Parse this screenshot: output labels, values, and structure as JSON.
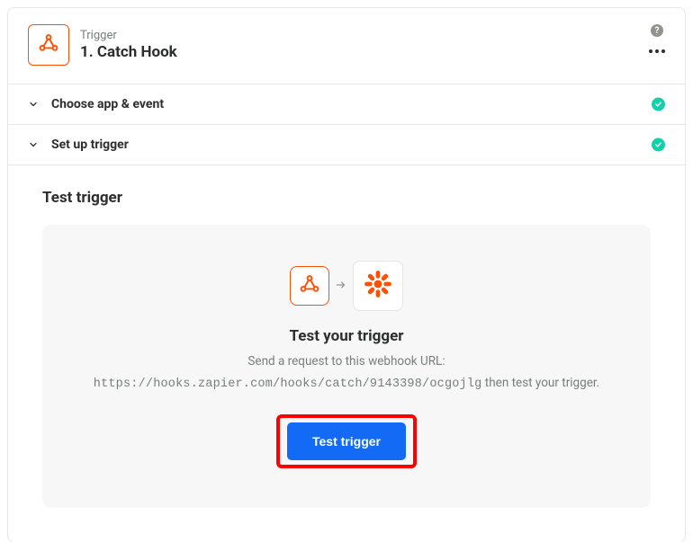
{
  "header": {
    "eyebrow": "Trigger",
    "title": "1. Catch Hook",
    "app_icon": "webhook-icon",
    "help_glyph": "?",
    "more_glyph": "dots"
  },
  "sections": {
    "choose": {
      "label": "Choose app & event",
      "completed": true
    },
    "setup": {
      "label": "Set up trigger",
      "completed": true
    }
  },
  "test": {
    "heading": "Test trigger",
    "panel_title": "Test your trigger",
    "instruction": "Send a request to this webhook URL:",
    "webhook_url": "https://hooks.zapier.com/hooks/catch/9143398/ocgojlg",
    "after_url": " then test your trigger.",
    "button_label": "Test trigger"
  },
  "colors": {
    "accent_orange": "#ff4f00",
    "primary_blue": "#136bf5",
    "success_teal": "#13d0ab",
    "highlight_red": "#ff0000"
  }
}
